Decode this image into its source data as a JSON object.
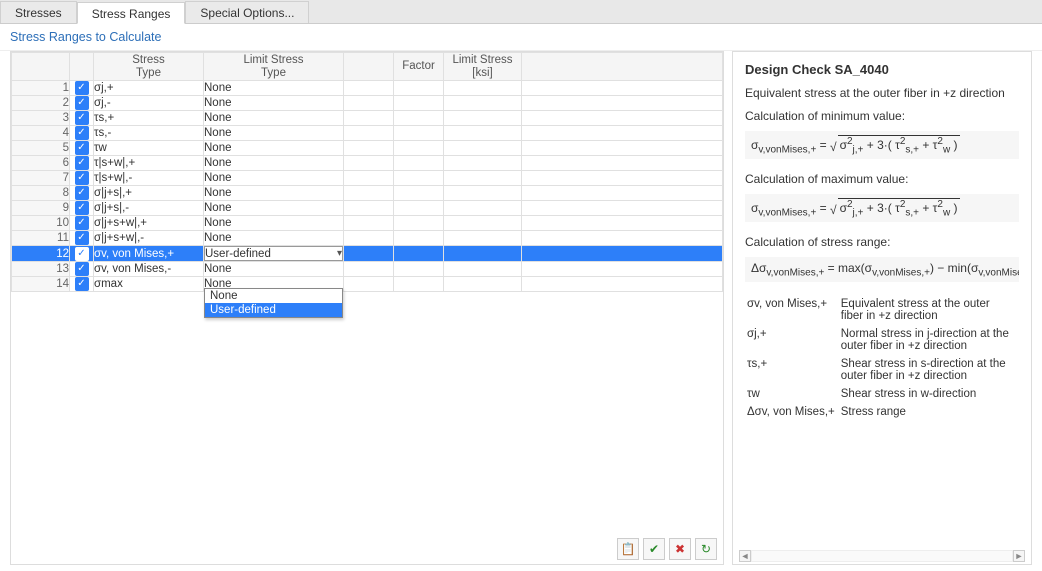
{
  "tabs": [
    "Stresses",
    "Stress Ranges",
    "Special Options..."
  ],
  "active_tab_index": 1,
  "section_title": "Stress Ranges to Calculate",
  "columns": {
    "stress_type": "Stress\nType",
    "limit_type": "Limit Stress\nType",
    "factor": "Factor",
    "limit_ksi": "Limit Stress\n[ksi]"
  },
  "rows": [
    {
      "n": 1,
      "checked": true,
      "stress": "σj,+",
      "limit": "None"
    },
    {
      "n": 2,
      "checked": true,
      "stress": "σj,-",
      "limit": "None"
    },
    {
      "n": 3,
      "checked": true,
      "stress": "τs,+",
      "limit": "None"
    },
    {
      "n": 4,
      "checked": true,
      "stress": "τs,-",
      "limit": "None"
    },
    {
      "n": 5,
      "checked": true,
      "stress": "τw",
      "limit": "None"
    },
    {
      "n": 6,
      "checked": true,
      "stress": "τ|s+w|,+",
      "limit": "None"
    },
    {
      "n": 7,
      "checked": true,
      "stress": "τ|s+w|,-",
      "limit": "None"
    },
    {
      "n": 8,
      "checked": true,
      "stress": "σ|j+s|,+",
      "limit": "None"
    },
    {
      "n": 9,
      "checked": true,
      "stress": "σ|j+s|,-",
      "limit": "None"
    },
    {
      "n": 10,
      "checked": true,
      "stress": "σ|j+s+w|,+",
      "limit": "None"
    },
    {
      "n": 11,
      "checked": true,
      "stress": "σ|j+s+w|,-",
      "limit": "None"
    },
    {
      "n": 12,
      "checked": true,
      "stress": "σv, von Mises,+",
      "limit": "User-defined",
      "selected": true,
      "dropdown": true
    },
    {
      "n": 13,
      "checked": true,
      "stress": "σv, von Mises,-",
      "limit": "None"
    },
    {
      "n": 14,
      "checked": true,
      "stress": "σmax",
      "limit": "None"
    }
  ],
  "dropdown_options": [
    "None",
    "User-defined"
  ],
  "dropdown_highlight_index": 1,
  "toolbar_icons": [
    "clipboard-icon",
    "check-all-icon",
    "uncheck-all-icon",
    "refresh-icon"
  ],
  "right_panel": {
    "title": "Design Check SA_4040",
    "subtitle": "Equivalent stress at the outer fiber in +z direction",
    "calc_min_label": "Calculation of minimum value:",
    "formula_min": "σv,vonMises,+ = √( σ²j,+ + 3·( τ²s,+ + τ²w ) )",
    "calc_max_label": "Calculation of maximum value:",
    "formula_max": "σv,vonMises,+ = √( σ²j,+ + 3·( τ²s,+ + τ²w ) )",
    "calc_range_label": "Calculation of stress range:",
    "formula_range": "Δσv,vonMises,+ = max(σv,vonMises,+) − min(σv,vonMises,+)",
    "symbols": [
      {
        "sym": "σv, von Mises,+",
        "desc": "Equivalent stress at the outer fiber in +z direction"
      },
      {
        "sym": "σj,+",
        "desc": "Normal stress in j-direction at the outer fiber in +z direction"
      },
      {
        "sym": "τs,+",
        "desc": "Shear stress in s-direction at the outer fiber in +z direction"
      },
      {
        "sym": "τw",
        "desc": "Shear stress in w-direction"
      },
      {
        "sym": "Δσv, von Mises,+",
        "desc": "Stress range"
      }
    ]
  }
}
